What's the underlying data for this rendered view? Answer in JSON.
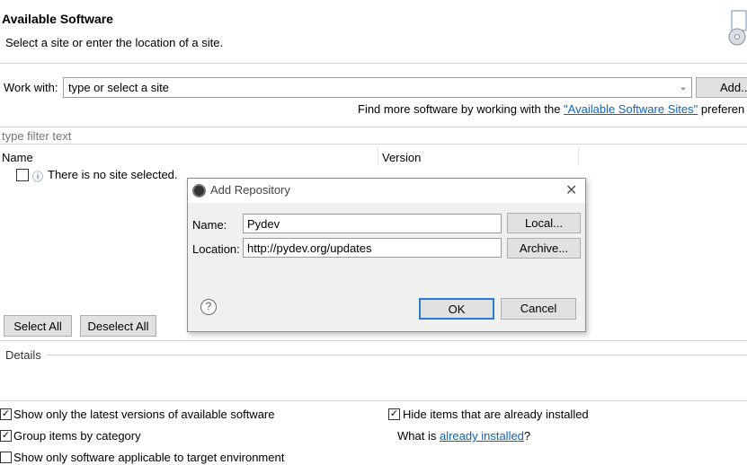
{
  "header": {
    "title": "Available Software",
    "subtitle": "Select a site or enter the location of a site."
  },
  "work_with": {
    "label": "Work with:",
    "value": "type or select a site",
    "add_button": "Add..."
  },
  "find_more": {
    "prefix": "Find more software by working with the ",
    "link": "\"Available Software Sites\"",
    "suffix": " preferen"
  },
  "filter": {
    "placeholder": "type filter text"
  },
  "table": {
    "columns": [
      "Name",
      "Version"
    ],
    "empty_message": "There is no site selected."
  },
  "buttons": {
    "select_all": "Select All",
    "deselect_all": "Deselect All"
  },
  "details": {
    "label": "Details"
  },
  "options": {
    "show_latest": {
      "label": "Show only the latest versions of available software",
      "checked": true
    },
    "group_by_category": {
      "label": "Group items by category",
      "checked": true
    },
    "show_applicable": {
      "label": "Show only software applicable to target environment",
      "checked": false
    },
    "hide_installed": {
      "label": "Hide items that are already installed",
      "checked": true
    },
    "what_is": {
      "prefix": "What is ",
      "link": "already installed",
      "suffix": "?"
    }
  },
  "dialog": {
    "title": "Add Repository",
    "name_label": "Name:",
    "name_value": "Pydev",
    "location_label": "Location:",
    "location_value": "http://pydev.org/updates",
    "local_button": "Local...",
    "archive_button": "Archive...",
    "ok_button": "OK",
    "cancel_button": "Cancel"
  }
}
